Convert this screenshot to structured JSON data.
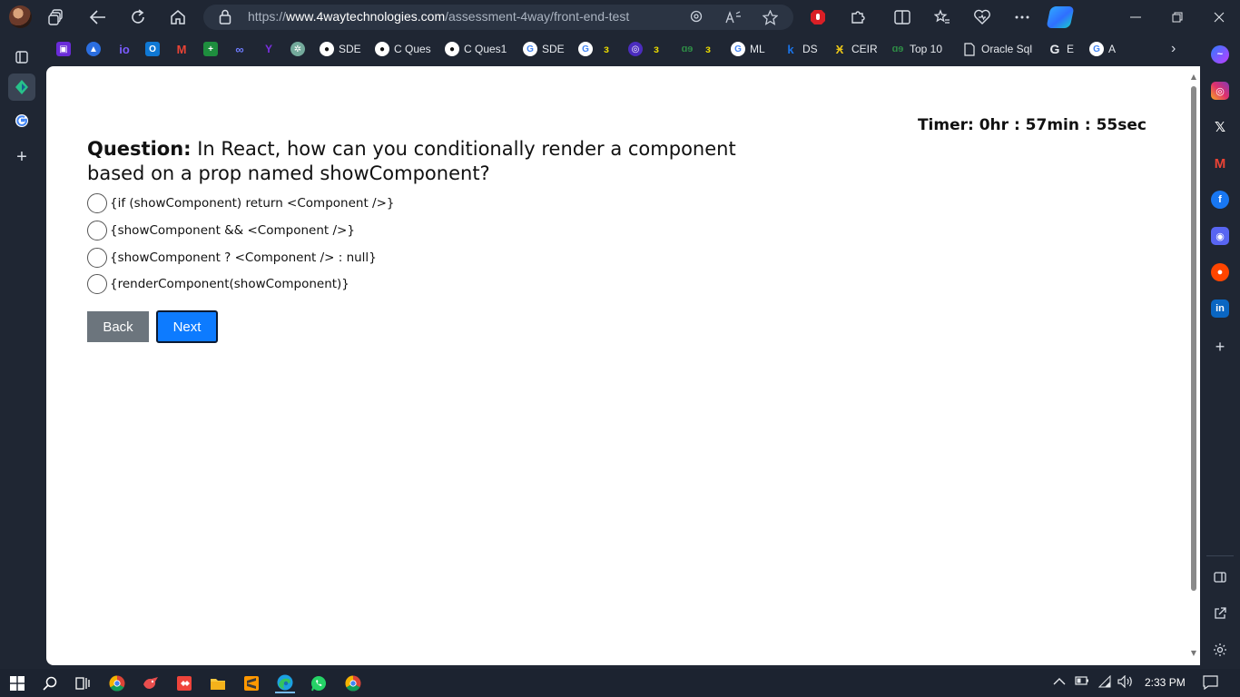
{
  "browser": {
    "url_prefix": "https://",
    "url_domain": "www.4waytechnologies.com",
    "url_path": "/assessment-4way/front-end-test"
  },
  "favorites": [
    {
      "label": "",
      "icon": "ext-icon",
      "color": "#6a2bd9"
    },
    {
      "label": "",
      "icon": "flame-icon",
      "color": "#2b6ee0"
    },
    {
      "label": "",
      "icon": "io-icon",
      "color": "#6a4cff"
    },
    {
      "label": "",
      "icon": "outlook-icon",
      "color": "#0f78d4"
    },
    {
      "label": "",
      "icon": "gmail-icon",
      "color": "#d93025"
    },
    {
      "label": "",
      "icon": "sheets-icon",
      "color": "#1e8e3e"
    },
    {
      "label": "",
      "icon": "link-icon",
      "color": "#4b57d6"
    },
    {
      "label": "",
      "icon": "yahoo-icon",
      "color": "#6001d2"
    },
    {
      "label": "",
      "icon": "chatgpt-icon",
      "color": "#74aa9c"
    },
    {
      "label": "SDE",
      "icon": "github-icon",
      "color": "#ffffff"
    },
    {
      "label": "C Ques",
      "icon": "github-icon",
      "color": "#ffffff"
    },
    {
      "label": "C Ques1",
      "icon": "github-icon",
      "color": "#ffffff"
    },
    {
      "label": "SDE",
      "icon": "google-icon",
      "color": "#ffffff"
    },
    {
      "label": "",
      "icon": "google-icon",
      "color": "#ffffff"
    },
    {
      "label": "",
      "icon": "gfg-icon",
      "color": "#2f8d46"
    },
    {
      "label": "",
      "icon": "leetcode-icon",
      "color": "#4b2cbf"
    },
    {
      "label": "",
      "icon": "gfg-icon",
      "color": "#2f8d46"
    },
    {
      "label": "",
      "icon": "gfg-green-icon",
      "color": "#2f8d46"
    },
    {
      "label": "",
      "icon": "gfg-icon",
      "color": "#2f8d46"
    },
    {
      "label": "ML",
      "icon": "google-icon",
      "color": "#ffffff"
    },
    {
      "label": "DS",
      "icon": "k-icon",
      "color": "#1a73e8"
    },
    {
      "label": "CEIR",
      "icon": "ceir-icon",
      "color": "#e8c419"
    },
    {
      "label": "Top 10",
      "icon": "gfg-icon",
      "color": "#2f8d46"
    },
    {
      "label": "Oracle Sql",
      "icon": "page-icon",
      "color": "#ffffff"
    },
    {
      "label": "E",
      "icon": "google-icon",
      "color": "#ffffff"
    },
    {
      "label": "A",
      "icon": "google-icon",
      "color": "#ffffff"
    }
  ],
  "assessment": {
    "timer": "Timer: 0hr : 57min : 55sec",
    "question_prefix": "Question:",
    "question_text": " In React, how can you conditionally render a component based on a prop named showComponent?",
    "options": [
      "{if (showComponent) return <Component />}",
      "{showComponent && <Component />}",
      "{showComponent ? <Component /> : null}",
      "{renderComponent(showComponent)}"
    ],
    "back_label": "Back",
    "next_label": "Next",
    "next_color": "#0d7bff",
    "back_color": "#6c757d"
  },
  "taskbar": {
    "clock": "2:33 PM"
  }
}
